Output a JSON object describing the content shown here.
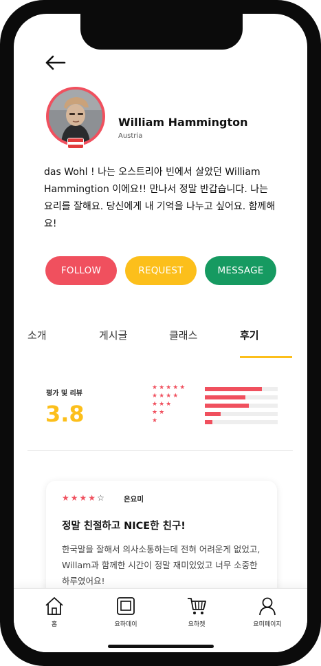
{
  "profile": {
    "name": "William Hammington",
    "country": "Austria",
    "bio": "das Wohl ! 나는 오스트리아 빈에서 살았던 William Hammingtion 이에요!! 만나서 정말 반갑습니다. 나는 요리를 잘해요. 당신에게 내 기억을 나누고 싶어요. 함께해요!"
  },
  "actions": {
    "follow": "FOLLOW",
    "request": "REQUEST",
    "message": "MESSAGE"
  },
  "tabs": [
    {
      "label": "소개"
    },
    {
      "label": "게시글"
    },
    {
      "label": "클래스"
    },
    {
      "label": "후기",
      "active": true
    }
  ],
  "rating": {
    "label": "평가 및 리뷰",
    "value": "3.8",
    "distribution": [
      {
        "stars": 5,
        "fraction": 0.78
      },
      {
        "stars": 4,
        "fraction": 0.56
      },
      {
        "stars": 3,
        "fraction": 0.6
      },
      {
        "stars": 2,
        "fraction": 0.22
      },
      {
        "stars": 1,
        "fraction": 0.1
      }
    ]
  },
  "review": {
    "stars": 4,
    "max_stars": 5,
    "author": "은요미",
    "title": "정말 친절하고 NICE한 친구!",
    "body": "한국말을 잘해서 의사소통하는데 전혀 어려운게 없었고, Willam과 함께한 시간이 정말 재미있었고 너무 소중한 하루였어요!"
  },
  "nav": [
    {
      "label": "홈",
      "icon": "home-icon"
    },
    {
      "label": "요하데이",
      "icon": "photo-frame-icon"
    },
    {
      "label": "요하켓",
      "icon": "cart-icon"
    },
    {
      "label": "요미페이지",
      "icon": "person-icon"
    }
  ],
  "colors": {
    "red": "#f0505e",
    "yellow": "#fcbf1b",
    "green": "#169a61"
  }
}
